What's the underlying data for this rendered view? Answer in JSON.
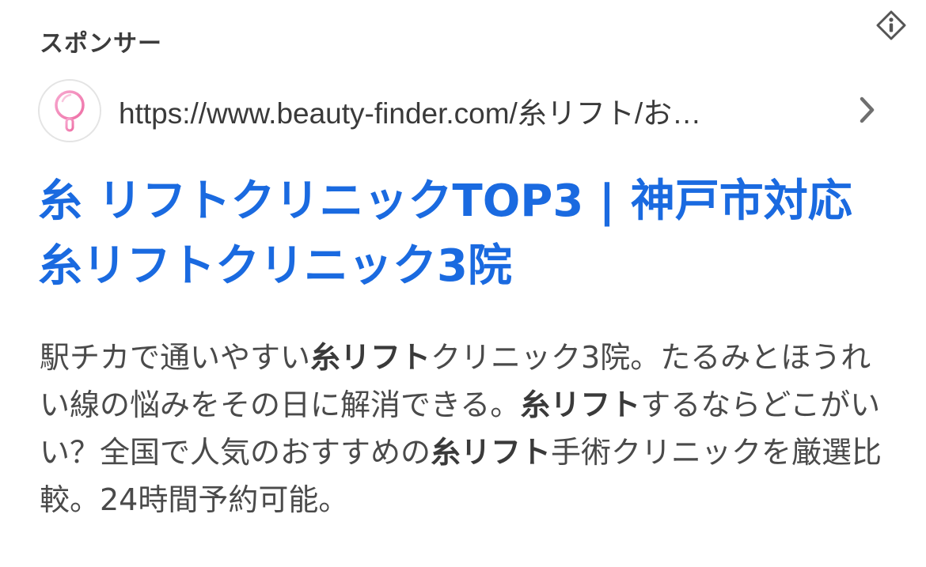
{
  "ad": {
    "sponsor_label": "スポンサー",
    "url": "https://www.beauty-finder.com/糸リフト/お…",
    "headline": "糸 リフトクリニックTOP3 | 神戸市対応糸リフトクリニック3院",
    "snippet": [
      {
        "text": "駅チカで通いやすい",
        "bold": false
      },
      {
        "text": "糸リフト",
        "bold": true
      },
      {
        "text": "クリニック3院。たるみとほうれい線の悩みをその日に解消できる。",
        "bold": false
      },
      {
        "text": "糸リフト",
        "bold": true
      },
      {
        "text": "するならどこがいい？全国で人気のおすすめの",
        "bold": false
      },
      {
        "text": "糸リフト",
        "bold": true
      },
      {
        "text": "手術クリニックを厳選比較。24時間予約可能。",
        "bold": false
      }
    ]
  },
  "icons": {
    "info": "info-diamond-icon",
    "favicon": "pink-mirror-logo-icon",
    "chevron": "chevron-right-icon"
  },
  "colors": {
    "headline": "#1a6ae0",
    "body_text": "#4a4a4a",
    "favicon_pink": "#f48ab8"
  }
}
